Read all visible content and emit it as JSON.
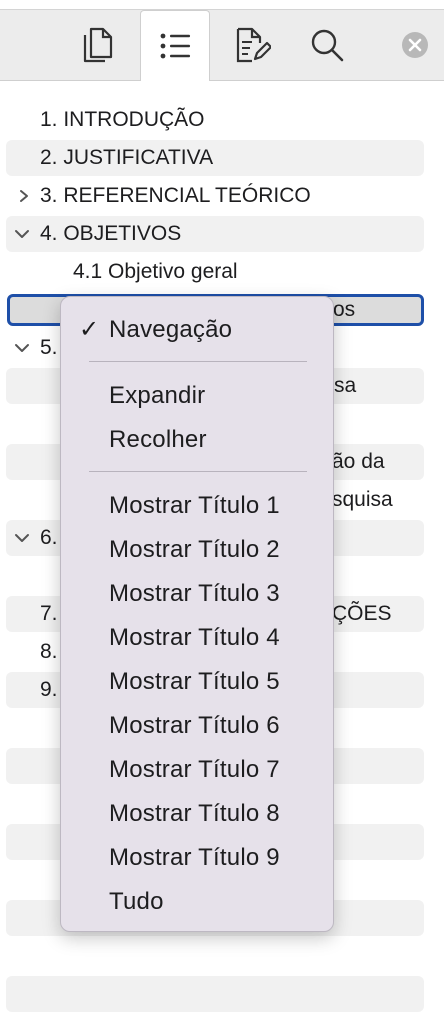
{
  "toolbar": {
    "tabs": [
      {
        "name": "thumbnails",
        "icon": "pages-icon"
      },
      {
        "name": "navigation",
        "icon": "list-icon",
        "active": true
      },
      {
        "name": "review",
        "icon": "edit-document-icon"
      },
      {
        "name": "search",
        "icon": "search-icon"
      }
    ],
    "close_icon": "close-icon"
  },
  "outline": {
    "items": [
      {
        "text": "1. INTRODUÇÃO",
        "chevron": "none"
      },
      {
        "text": "2. JUSTIFICATIVA",
        "chevron": "none"
      },
      {
        "text": "3. REFERENCIAL TEÓRICO",
        "chevron": "right"
      },
      {
        "text": "4. OBJETIVOS",
        "chevron": "down"
      },
      {
        "text": "4.1 Objetivo geral",
        "chevron": "none"
      },
      {
        "text": "os",
        "chevron": "none",
        "selected": true
      },
      {
        "text": "5.",
        "chevron": "down"
      },
      {
        "text": "sa",
        "chevron": "none"
      },
      {
        "text": "",
        "chevron": "none"
      },
      {
        "text": "ão da",
        "chevron": "none"
      },
      {
        "text": "squisa",
        "chevron": "none"
      },
      {
        "text": "6.",
        "chevron": "down"
      },
      {
        "text": "",
        "chevron": "none"
      },
      {
        "text": "7.",
        "chevron": "none",
        "suffix": "ÇÕES"
      },
      {
        "text": "8.",
        "chevron": "none"
      },
      {
        "text": "9.",
        "chevron": "none"
      }
    ]
  },
  "context_menu": {
    "checked_item": "Navegação",
    "group2": [
      "Expandir",
      "Recolher"
    ],
    "group3": [
      "Mostrar Título 1",
      "Mostrar Título 2",
      "Mostrar Título 3",
      "Mostrar Título 4",
      "Mostrar Título 5",
      "Mostrar Título 6",
      "Mostrar Título 7",
      "Mostrar Título 8",
      "Mostrar Título 9",
      "Tudo"
    ]
  },
  "colors": {
    "selection_border": "#1e4fa8",
    "menu_bg": "#e6e1ea",
    "stripe": "#f1f1f1"
  }
}
